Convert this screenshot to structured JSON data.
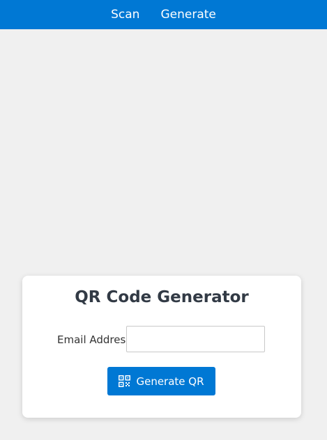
{
  "nav": {
    "items": [
      {
        "label": "Scan"
      },
      {
        "label": "Generate"
      }
    ]
  },
  "card": {
    "title": "QR Code Generator",
    "email_label": "Email Address",
    "email_value": "",
    "email_placeholder": "",
    "button_label": "Generate QR",
    "button_icon": "qr-code-icon"
  },
  "colors": {
    "accent": "#0078d4",
    "background": "#f0f0f0",
    "card": "#ffffff",
    "title_text": "#323a45"
  }
}
